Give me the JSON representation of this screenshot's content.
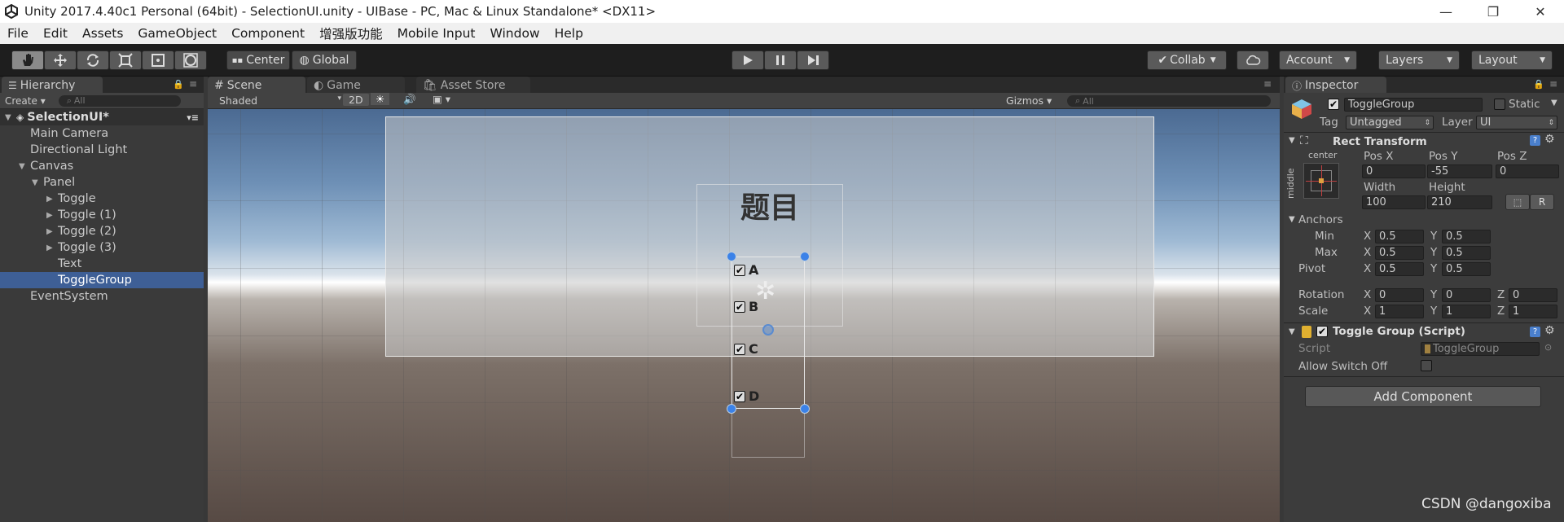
{
  "title_bar": {
    "title": "Unity 2017.4.40c1 Personal (64bit) - SelectionUI.unity - UIBase - PC, Mac & Linux Standalone* <DX11>",
    "minimize": "—",
    "restore": "❐",
    "close": "✕"
  },
  "menu": [
    "File",
    "Edit",
    "Assets",
    "GameObject",
    "Component",
    "增强版功能",
    "Mobile Input",
    "Window",
    "Help"
  ],
  "toolbar": {
    "pivot_label": "Center",
    "space_label": "Global",
    "collab_label": "Collab",
    "account_label": "Account",
    "layers_label": "Layers",
    "layout_label": "Layout"
  },
  "hierarchy": {
    "tab": "Hierarchy",
    "create_label": "Create",
    "search_placeholder": "All",
    "scene_name": "SelectionUI*",
    "items": [
      "Main Camera",
      "Directional Light",
      "Canvas",
      "Panel",
      "Toggle",
      "Toggle (1)",
      "Toggle (2)",
      "Toggle (3)",
      "Text",
      "ToggleGroup",
      "EventSystem"
    ],
    "selected": "ToggleGroup"
  },
  "scene": {
    "tabs": [
      "Scene",
      "Game",
      "Asset Store"
    ],
    "shading": "Shaded",
    "mode_2d": "2D",
    "gizmos": "Gizmos",
    "search_placeholder": "All",
    "heading": "题目",
    "options": [
      "A",
      "B",
      "C",
      "D"
    ]
  },
  "inspector": {
    "tab": "Inspector",
    "object_name": "ToggleGroup",
    "static_label": "Static",
    "tag_label": "Tag",
    "tag_value": "Untagged",
    "layer_label": "Layer",
    "layer_value": "UI",
    "rect_transform": {
      "title": "Rect Transform",
      "anchor_h": "center",
      "anchor_v": "middle",
      "pos_x_label": "Pos X",
      "pos_y_label": "Pos Y",
      "pos_z_label": "Pos Z",
      "pos_x": "0",
      "pos_y": "-55",
      "pos_z": "0",
      "width_label": "Width",
      "height_label": "Height",
      "width": "100",
      "height": "210",
      "r_button": "R",
      "anchors_label": "Anchors",
      "min_label": "Min",
      "max_label": "Max",
      "pivot_label": "Pivot",
      "x_label": "X",
      "y_label": "Y",
      "z_label": "Z",
      "anchor_min_x": "0.5",
      "anchor_min_y": "0.5",
      "anchor_max_x": "0.5",
      "anchor_max_y": "0.5",
      "pivot_x": "0.5",
      "pivot_y": "0.5",
      "rotation_label": "Rotation",
      "rot_x": "0",
      "rot_y": "0",
      "rot_z": "0",
      "scale_label": "Scale",
      "scale_x": "1",
      "scale_y": "1",
      "scale_z": "1"
    },
    "toggle_group": {
      "title": "Toggle Group (Script)",
      "script_label": "Script",
      "script_value": "ToggleGroup",
      "allow_switch_off_label": "Allow Switch Off"
    },
    "add_component": "Add Component"
  },
  "watermark": "CSDN @dangoxiba",
  "colors": {
    "selection": "#3e5f96",
    "panel_bg": "#3c3c3c",
    "toolbar_bg": "#1e1e1e",
    "handle_blue": "#3b82e8"
  }
}
